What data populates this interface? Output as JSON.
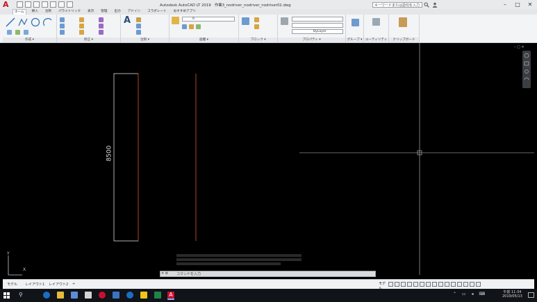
{
  "titlebar": {
    "app_title": "Autodesk AutoCAD LT 2019",
    "file_name": "作業3_nodriver_nodriver_nodriver02.dwg",
    "search_placeholder": "キーワードまたは語句を入力"
  },
  "ribbon": {
    "tabs": [
      "ホーム",
      "挿入",
      "注釈",
      "パラメトリック",
      "表示",
      "管理",
      "出力",
      "アドイン",
      "コラボレート",
      "おすすめアプリ"
    ],
    "active_tab": "ホーム",
    "panels": [
      {
        "label": "作成 ▾"
      },
      {
        "label": "修正 ▾"
      },
      {
        "label": "注釈 ▾"
      },
      {
        "label": "画層 ▾"
      },
      {
        "label": "ブロック ▾"
      },
      {
        "label": "プロパティ ▾"
      },
      {
        "label": "グループ ▾"
      },
      {
        "label": "ユーティリティ ▾"
      },
      {
        "label": "クリップボード"
      }
    ],
    "text_tool": "A",
    "layer_value": "0",
    "property_value": "ByLayer"
  },
  "drawing": {
    "dimension": "8500",
    "ucs_x": "X",
    "ucs_y": "Y"
  },
  "command": {
    "prompt": "コマンドを入力",
    "buttons": "✕ ⚙"
  },
  "layout": {
    "tabs": [
      "モデル",
      "レイアウト1",
      "レイアウト2",
      "+"
    ]
  },
  "status": {
    "model_label": "モデル"
  },
  "taskbar": {
    "time": "午前 11:34",
    "date": "2019/05/13"
  },
  "colors": {
    "canvas": "#000000",
    "autocad_red": "#c8102e",
    "dim_line": "#dddddd",
    "wall_line": "#b2461f"
  }
}
